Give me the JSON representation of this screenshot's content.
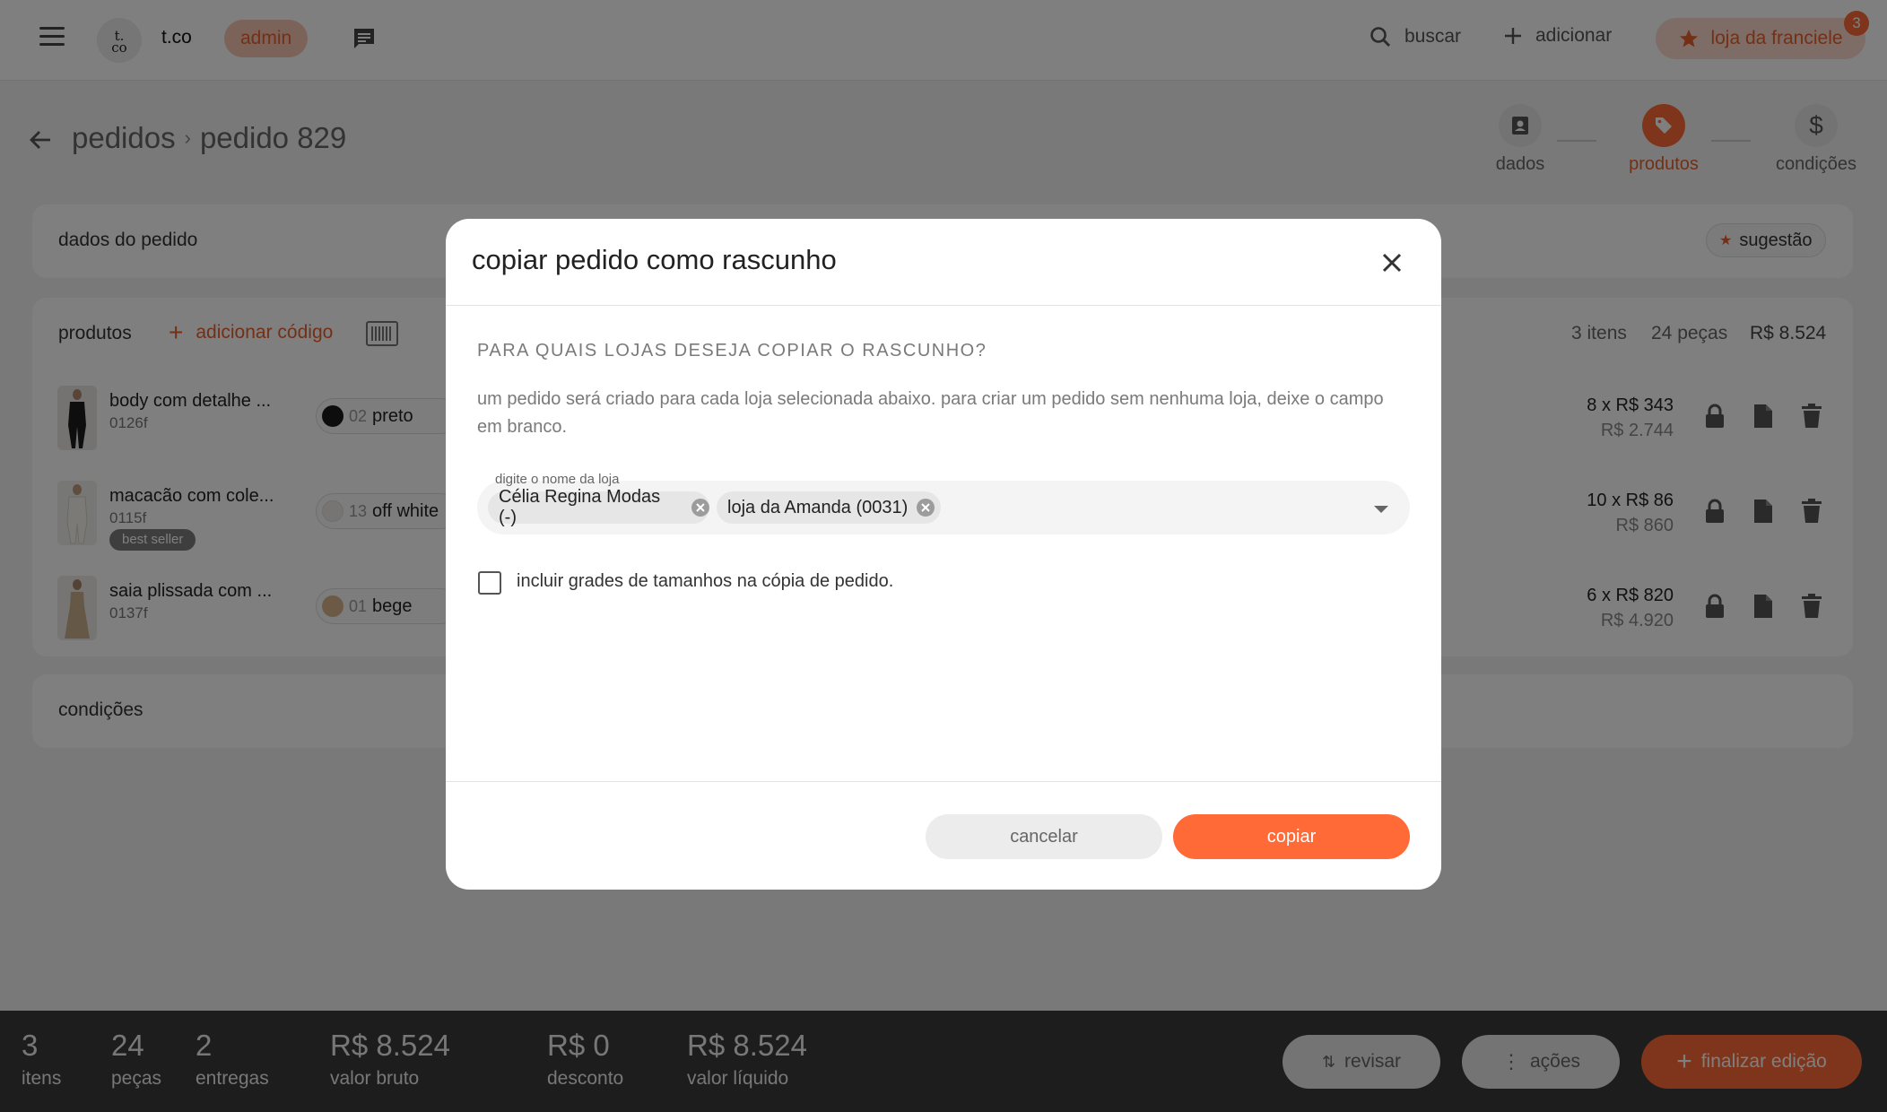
{
  "topbar": {
    "brand": "t.co",
    "logo_text": "t.\nco",
    "role_badge": "admin",
    "search_label": "buscar",
    "add_label": "adicionar",
    "store_label": "loja da franciele",
    "notification_count": "3"
  },
  "page": {
    "breadcrumb_parent": "pedidos",
    "breadcrumb_current": "pedido 829",
    "steps": [
      {
        "label": "dados",
        "icon": "contact-card-icon",
        "active": false
      },
      {
        "label": "produtos",
        "icon": "tag-icon",
        "active": true
      },
      {
        "label": "condições",
        "icon": "dollar-icon",
        "active": false
      }
    ]
  },
  "order_data_card": {
    "title": "dados do pedido",
    "suggestion_label": "sugestão"
  },
  "products_card": {
    "title": "produtos",
    "add_code_label": "adicionar código",
    "items_count": "3 itens",
    "pieces_count": "24 peças",
    "total": "R$ 8.524",
    "rows": [
      {
        "name": "body com detalhe ...",
        "code": "0126f",
        "badge": "",
        "color_code": "02",
        "color_name": "preto",
        "swatch": "#1a1a1a",
        "qty": "8 x R$ 343",
        "subtotal": "R$ 2.744"
      },
      {
        "name": "macacão com cole...",
        "code": "0115f",
        "badge": "best seller",
        "color_code": "13",
        "color_name": "off white",
        "swatch": "#ecebe6",
        "qty": "10 x R$ 86",
        "subtotal": "R$ 860"
      },
      {
        "name": "saia plissada com ...",
        "code": "0137f",
        "badge": "",
        "color_code": "01",
        "color_name": "bege",
        "swatch": "#d8b58e",
        "qty": "6 x R$ 820",
        "subtotal": "R$ 4.920"
      }
    ]
  },
  "conditions_card": {
    "title": "condições"
  },
  "bottombar": {
    "items_value": "3",
    "items_label": "itens",
    "pieces_value": "24",
    "pieces_label": "peças",
    "deliveries_value": "2",
    "deliveries_label": "entregas",
    "gross_value": "R$ 8.524",
    "gross_label": "valor bruto",
    "discount_value": "R$ 0",
    "discount_label": "desconto",
    "net_value": "R$ 8.524",
    "net_label": "valor líquido",
    "review_label": "revisar",
    "actions_label": "ações",
    "finish_label": "finalizar edição"
  },
  "modal": {
    "title": "copiar pedido como rascunho",
    "question": "PARA QUAIS LOJAS DESEJA COPIAR O RASCUNHO?",
    "description": "um pedido será criado para cada loja selecionada abaixo. para criar um pedido sem nenhuma loja, deixe o campo em branco.",
    "field_label": "digite o nome da loja",
    "chips": [
      "Célia Regina Modas (-)",
      "loja da Amanda (0031)"
    ],
    "checkbox_label": "incluir grades de tamanhos na cópia de pedido.",
    "cancel_label": "cancelar",
    "copy_label": "copiar"
  },
  "colors": {
    "accent": "#ff6a36",
    "accent_text": "#e6602f"
  }
}
